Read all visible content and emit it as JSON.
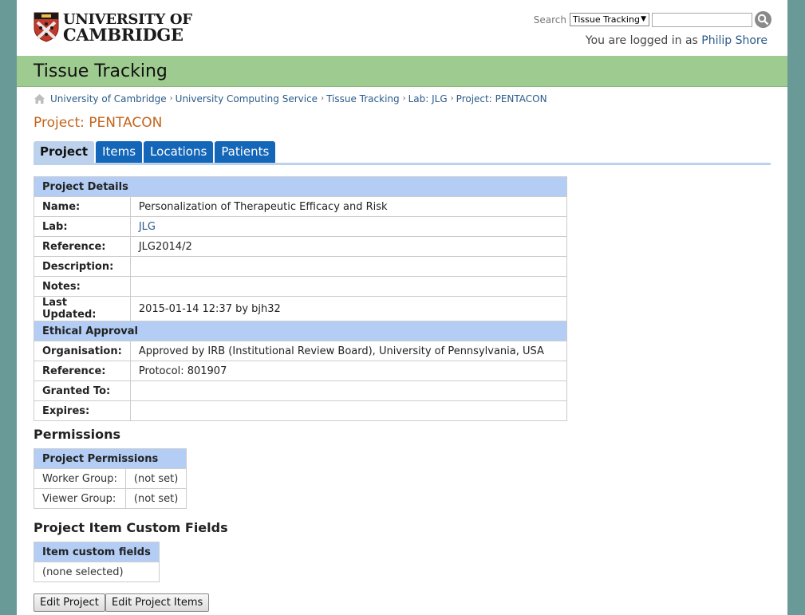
{
  "header": {
    "logo_line1": "UNIVERSITY OF",
    "logo_line2": "CAMBRIDGE",
    "search_label": "Search",
    "search_scope": "Tissue Tracking",
    "search_value": "",
    "login_prefix": "You are logged in as",
    "user_name": "Philip Shore"
  },
  "site_title": "Tissue Tracking",
  "breadcrumb": [
    "University of Cambridge",
    "University Computing Service",
    "Tissue Tracking",
    "Lab: JLG",
    "Project: PENTACON"
  ],
  "page_title": "Project: PENTACON",
  "tabs": [
    {
      "label": "Project",
      "active": true
    },
    {
      "label": "Items",
      "active": false
    },
    {
      "label": "Locations",
      "active": false
    },
    {
      "label": "Patients",
      "active": false
    }
  ],
  "project_details": {
    "heading": "Project Details",
    "rows": [
      {
        "label": "Name:",
        "value": "Personalization of Therapeutic Efficacy and Risk"
      },
      {
        "label": "Lab:",
        "value": "JLG"
      },
      {
        "label": "Reference:",
        "value": "JLG2014/2"
      },
      {
        "label": "Description:",
        "value": ""
      },
      {
        "label": "Notes:",
        "value": ""
      },
      {
        "label": "Last Updated:",
        "value": "2015-01-14 12:37 by bjh32"
      }
    ]
  },
  "ethical_approval": {
    "heading": "Ethical Approval",
    "rows": [
      {
        "label": "Organisation:",
        "value": "Approved by IRB (Institutional Review Board), University of Pennsylvania, USA"
      },
      {
        "label": "Reference:",
        "value": "Protocol: 801907"
      },
      {
        "label": "Granted To:",
        "value": ""
      },
      {
        "label": "Expires:",
        "value": ""
      }
    ]
  },
  "permissions": {
    "section_title": "Permissions",
    "heading": "Project Permissions",
    "rows": [
      {
        "label": "Worker Group:",
        "value": "(not set)"
      },
      {
        "label": "Viewer Group:",
        "value": "(not set)"
      }
    ]
  },
  "custom_fields": {
    "section_title": "Project Item Custom Fields",
    "heading": "Item custom fields",
    "value": "(none selected)"
  },
  "buttons": {
    "edit_project": "Edit Project",
    "edit_items": "Edit Project Items"
  },
  "colors": {
    "title_bar": "#9ecb8f",
    "tab_blue": "#1466b8",
    "section_header": "#b3cdf5",
    "page_title": "#c4641c",
    "background": "#6a9a98"
  }
}
